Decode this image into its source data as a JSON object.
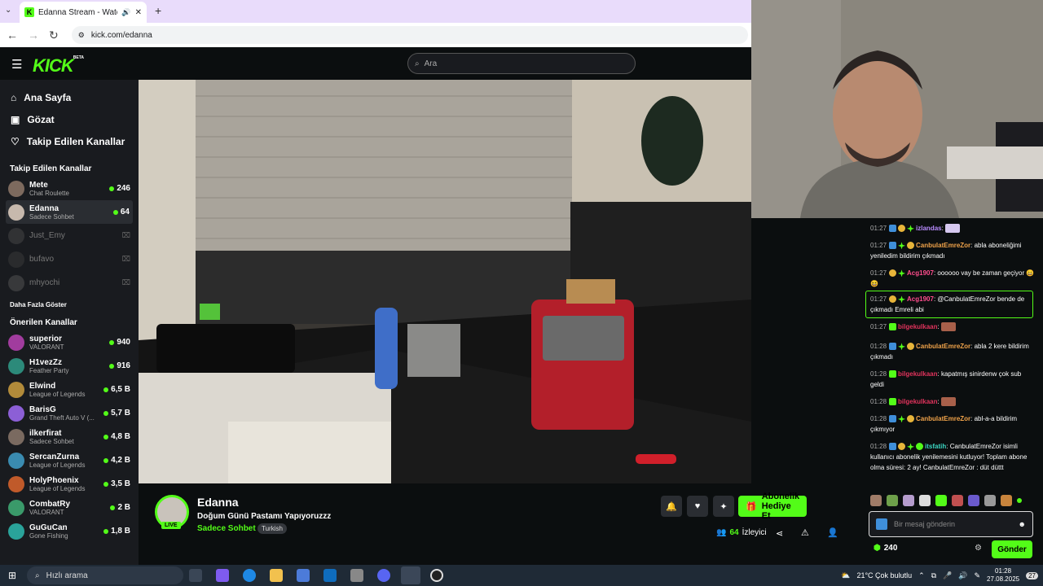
{
  "browser": {
    "tab_title": "Edanna Stream - Watch Live",
    "url": "kick.com/edanna"
  },
  "header": {
    "logo": "KICK",
    "logo_badge": "BETA",
    "search_placeholder": "Ara"
  },
  "sidebar": {
    "nav": [
      {
        "label": "Ana Sayfa",
        "icon": "home-icon"
      },
      {
        "label": "Gözat",
        "icon": "browse-icon"
      },
      {
        "label": "Takip Edilen Kanallar",
        "icon": "heart-icon"
      }
    ],
    "followed_title": "Takip Edilen Kanallar",
    "followed": [
      {
        "name": "Mete",
        "category": "Chat Roulette",
        "viewers": "246",
        "live": true
      },
      {
        "name": "Edanna",
        "category": "Sadece Sohbet",
        "viewers": "64",
        "live": true,
        "selected": true
      },
      {
        "name": "Just_Emy",
        "category": "",
        "viewers": "",
        "live": false
      },
      {
        "name": "bufavo",
        "category": "",
        "viewers": "",
        "live": false
      },
      {
        "name": "mhyochi",
        "category": "",
        "viewers": "",
        "live": false
      }
    ],
    "show_more": "Daha Fazla Göster",
    "recommended_title": "Önerilen Kanallar",
    "recommended": [
      {
        "name": "superior",
        "category": "VALORANT",
        "viewers": "940"
      },
      {
        "name": "H1vezZz",
        "category": "Feather Party",
        "viewers": "916"
      },
      {
        "name": "Elwind",
        "category": "League of Legends",
        "viewers": "6,5 B"
      },
      {
        "name": "BarisG",
        "category": "Grand Theft Auto V (...",
        "viewers": "5,7 B"
      },
      {
        "name": "ilkerfirat",
        "category": "Sadece Sohbet",
        "viewers": "4,8 B"
      },
      {
        "name": "SercanZurna",
        "category": "League of Legends",
        "viewers": "4,2 B"
      },
      {
        "name": "HolyPhoenix",
        "category": "League of Legends",
        "viewers": "3,5 B"
      },
      {
        "name": "CombatRy",
        "category": "VALORANT",
        "viewers": "2 B"
      },
      {
        "name": "GuGuCan",
        "category": "Gone Fishing",
        "viewers": "1,8 B"
      }
    ]
  },
  "stream": {
    "channel": "Edanna",
    "live_badge": "LIVE",
    "title": "Doğum Günü Pastamı Yapıyoruzzz",
    "category": "Sadece Sohbet",
    "tag": "Turkish",
    "gift_button": "Abonelik Hediye Et",
    "viewers": "64",
    "viewers_label": "İzleyici"
  },
  "chat": {
    "messages": [
      {
        "time": "01:27",
        "user": "izlandas",
        "color": "#b98cff",
        "text": "",
        "emote": true
      },
      {
        "time": "01:27",
        "user": "CanbulatEmreZor",
        "color": "#f0a34a",
        "text": "abla aboneliğimi yeniledim bildirim çıkmadı"
      },
      {
        "time": "01:27",
        "user": "Acg1907",
        "color": "#ff4d8d",
        "text": "oooooo vay be zaman geçiyor 😄😆"
      },
      {
        "time": "01:27",
        "user": "Acg1907",
        "color": "#ff4d8d",
        "text": "@CanbulatEmreZor bende de çıkmadı Emreli abi",
        "highlight": true
      },
      {
        "time": "01:27",
        "user": "bilgekulkaan",
        "color": "#e0335c",
        "text": "",
        "emote": true
      },
      {
        "time": "01:28",
        "user": "CanbulatEmreZor",
        "color": "#f0a34a",
        "text": "abla 2 kere bildirim çıkmadı"
      },
      {
        "time": "01:28",
        "user": "bilgekulkaan",
        "color": "#e0335c",
        "text": "kapatmış sinirdenw çok sub geldi"
      },
      {
        "time": "01:28",
        "user": "bilgekulkaan",
        "color": "#e0335c",
        "text": "",
        "emote": true
      },
      {
        "time": "01:28",
        "user": "CanbulatEmreZor",
        "color": "#f0a34a",
        "text": "abl-a-a bildirim çıkmıyor"
      },
      {
        "time": "01:28",
        "user": "itsfatih",
        "color": "#3cd6c2",
        "text": "CanbulatEmreZor isimli kullanıcı abonelik yenilemesini kutluyor! Toplam abone olma süresi: 2 ay! CanbulatEmreZor : düt düttt"
      }
    ],
    "input_placeholder": "Bir mesaj gönderin",
    "points": "240",
    "send_label": "Gönder"
  },
  "taskbar": {
    "search_placeholder": "Hızlı arama",
    "weather": "21°C  Çok bulutlu",
    "time": "01:28",
    "date": "27.08.2025",
    "notifications": "27"
  },
  "colors": {
    "accent": "#53fc18",
    "bg": "#0b0e0f",
    "sidebar": "#191b1f"
  }
}
